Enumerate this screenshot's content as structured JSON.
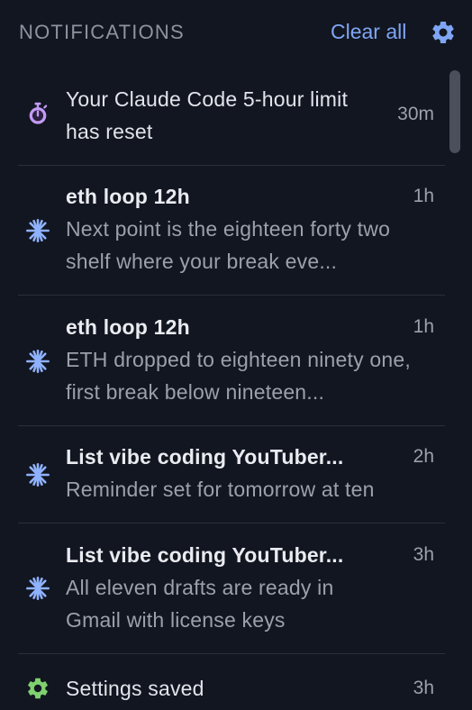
{
  "header": {
    "title": "NOTIFICATIONS",
    "clear_all_label": "Clear all",
    "settings_icon": "gear-icon"
  },
  "notifications": [
    {
      "icon": "stopwatch-icon",
      "icon_color": "#c49af5",
      "title": "Your Claude Code 5-hour limit has reset",
      "body": "",
      "time": "30m"
    },
    {
      "icon": "sparkle-icon",
      "icon_color": "#8fb2ff",
      "title": "eth loop 12h",
      "body": "Next point is the eighteen forty two shelf where your break eve...",
      "time": "1h"
    },
    {
      "icon": "sparkle-icon",
      "icon_color": "#8fb2ff",
      "title": "eth loop 12h",
      "body": "ETH dropped to eighteen ninety one, first break below nineteen...",
      "time": "1h"
    },
    {
      "icon": "sparkle-icon",
      "icon_color": "#8fb2ff",
      "title": "List vibe coding YouTuber...",
      "body": "Reminder set for tomorrow at ten",
      "time": "2h"
    },
    {
      "icon": "sparkle-icon",
      "icon_color": "#8fb2ff",
      "title": "List vibe coding YouTuber...",
      "body": "All eleven drafts are ready in Gmail with license keys",
      "time": "3h"
    },
    {
      "icon": "gear-icon",
      "icon_color": "#7fd16f",
      "title": "Settings saved",
      "body": "",
      "time": "3h"
    }
  ]
}
